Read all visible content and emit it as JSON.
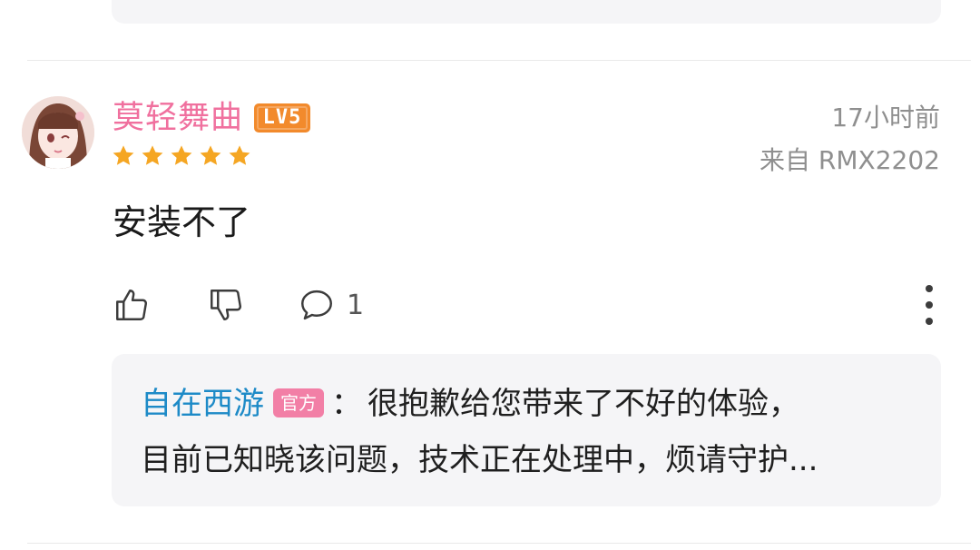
{
  "comment": {
    "username": "莫轻舞曲",
    "level_badge": "LV5",
    "rating_stars": 5,
    "time": "17小时前",
    "device": "来自 RMX2202",
    "text": "安装不了",
    "reply_count": "1"
  },
  "developer_reply": {
    "name": "自在西游",
    "badge": "官方",
    "colon": "：",
    "text_line1": "很抱歉给您带来了不好的体验，",
    "text_line2": "目前已知晓该问题，技术正在处理中，烦请守护..."
  },
  "colors": {
    "username": "#f0709e",
    "level_badge": "#f28a2c",
    "star": "#f5a623",
    "developer_name": "#1d8ac7",
    "official_badge": "#f27fa6"
  },
  "icons": {
    "like": "thumbs-up-icon",
    "dislike": "thumbs-down-icon",
    "reply": "comment-bubble-icon",
    "more": "more-vertical-icon"
  }
}
